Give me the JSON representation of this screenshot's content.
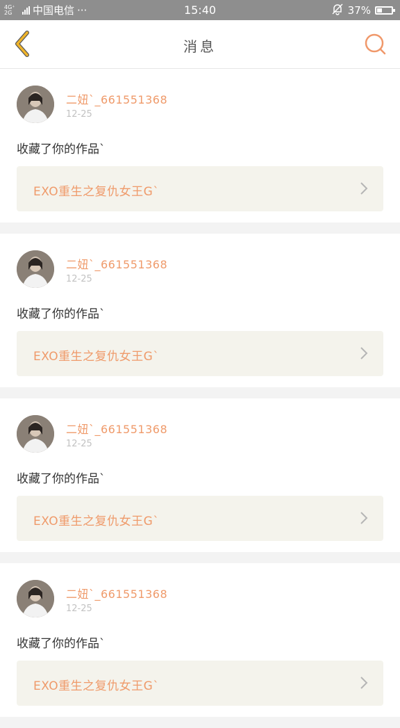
{
  "status_bar": {
    "network": "4G⁺ 4G\n2G",
    "carrier": "中国电信",
    "dots": "···",
    "time": "15:40",
    "battery_percent_label": "37%",
    "battery_level": 0.37,
    "icons": [
      "network-icon",
      "signal-icon",
      "bell-muted-icon",
      "battery-icon"
    ]
  },
  "nav": {
    "title": "消息",
    "back_icon": "chevron-left-icon",
    "search_icon": "search-icon",
    "accent_back": "#f0b429",
    "accent_search": "#f0986a"
  },
  "colors": {
    "accent": "#ef9a6a",
    "status_bar": "#8e8e8e",
    "card_bg": "#ffffff",
    "link_bg": "#f4f3ec",
    "page_bg": "#f3f3f3"
  },
  "messages": [
    {
      "username": "二妞`_661551368",
      "time": "12-25",
      "action": "收藏了你的作品`",
      "work_title": "EXO重生之复仇女王G`"
    },
    {
      "username": "二妞`_661551368",
      "time": "12-25",
      "action": "收藏了你的作品`",
      "work_title": "EXO重生之复仇女王G`"
    },
    {
      "username": "二妞`_661551368",
      "time": "12-25",
      "action": "收藏了你的作品`",
      "work_title": "EXO重生之复仇女王G`"
    },
    {
      "username": "二妞`_661551368",
      "time": "12-25",
      "action": "收藏了你的作品`",
      "work_title": "EXO重生之复仇女王G`"
    }
  ]
}
